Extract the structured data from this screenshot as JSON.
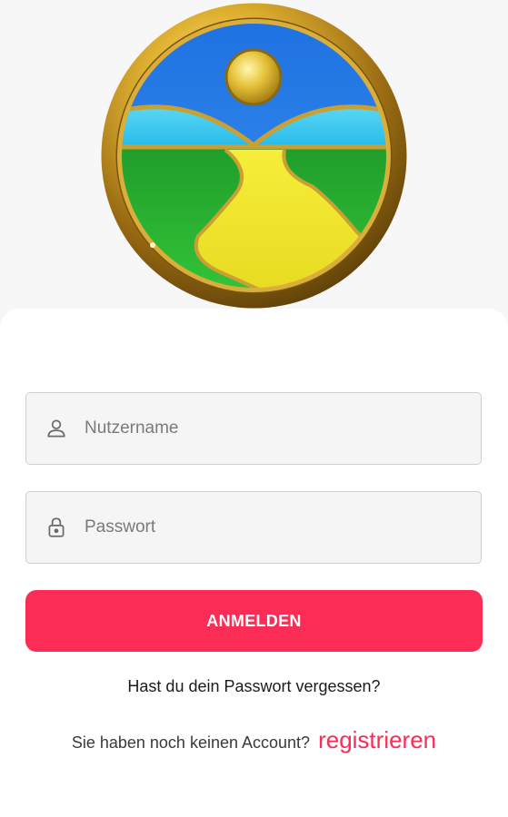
{
  "logo": {
    "icon": "landscape-emblem-icon"
  },
  "form": {
    "username_placeholder": "Nutzername",
    "password_placeholder": "Passwort",
    "username_icon": "user-icon",
    "password_icon": "lock-icon"
  },
  "actions": {
    "login_label": "ANMELDEN",
    "forgot_password": "Hast du dein Passwort vergessen?",
    "no_account_text": "Sie haben noch keinen Account?",
    "register_link": "registrieren"
  },
  "colors": {
    "accent": "#fb2c55",
    "field_bg": "#f5f5f5",
    "field_border": "#cfcfcf"
  }
}
